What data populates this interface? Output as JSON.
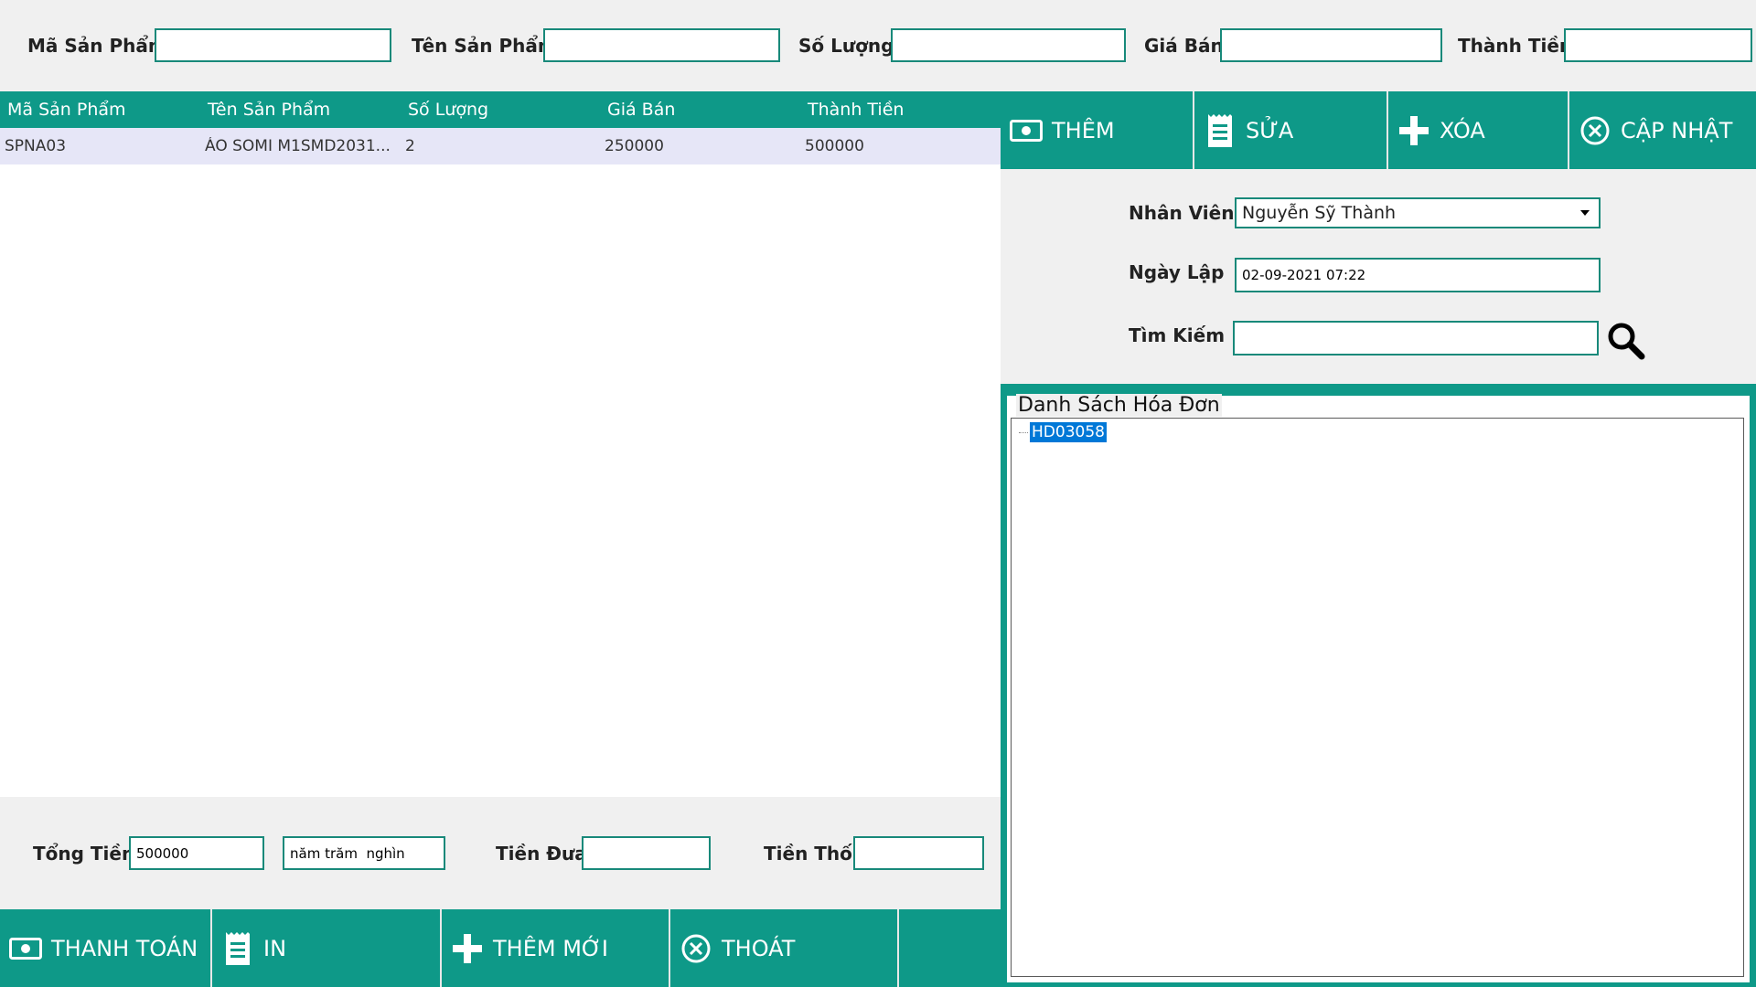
{
  "top_fields": [
    {
      "label": "Mã Sản Phẩm",
      "value": ""
    },
    {
      "label": "Tên Sản Phẩm",
      "value": ""
    },
    {
      "label": "Số Lượng",
      "value": ""
    },
    {
      "label": "Giá Bán",
      "value": ""
    },
    {
      "label": "Thành Tiền",
      "value": ""
    }
  ],
  "grid": {
    "columns": [
      "Mã Sản Phẩm",
      "Tên Sản Phẩm",
      "Số Lượng",
      "Giá Bán",
      "Thành Tiền"
    ],
    "rows": [
      [
        "SPNA03",
        "ÁO SOMI M1SMD2031...",
        "2",
        "250000",
        "500000"
      ]
    ]
  },
  "totals": {
    "total_label": "Tổng Tiền",
    "total_value": "500000",
    "total_words": "năm trăm  nghìn",
    "paid_label": "Tiền Đưa",
    "paid_value": "",
    "change_label": "Tiền Thối",
    "change_value": ""
  },
  "bottom_buttons": [
    {
      "label": "THANH TOÁN",
      "icon": "money-icon"
    },
    {
      "label": "IN",
      "icon": "receipt-icon"
    },
    {
      "label": "THÊM MỚI",
      "icon": "plus-icon"
    },
    {
      "label": "THOÁT",
      "icon": "close-circle-icon"
    },
    {
      "label": "",
      "icon": ""
    }
  ],
  "right_buttons": [
    {
      "label": "THÊM",
      "icon": "money-icon"
    },
    {
      "label": "SỬA",
      "icon": "receipt-icon"
    },
    {
      "label": "XÓA",
      "icon": "plus-icon"
    },
    {
      "label": "CẬP NHẬT",
      "icon": "close-circle-icon"
    }
  ],
  "info": {
    "employee_label": "Nhân Viên",
    "employee_value": "Nguyễn Sỹ Thành",
    "date_label": "Ngày Lập",
    "date_value": "02-09-2021 07:22",
    "search_label": "Tìm Kiếm",
    "search_value": "",
    "search_icon": "search-icon"
  },
  "invoice_tree": {
    "title": "Danh Sách Hóa Đơn",
    "items": [
      "HD03058"
    ]
  },
  "colors": {
    "accent": "#0e9988",
    "border": "#18897a",
    "row_selected": "#e6e6f7",
    "tree_selected": "#0078d7"
  }
}
